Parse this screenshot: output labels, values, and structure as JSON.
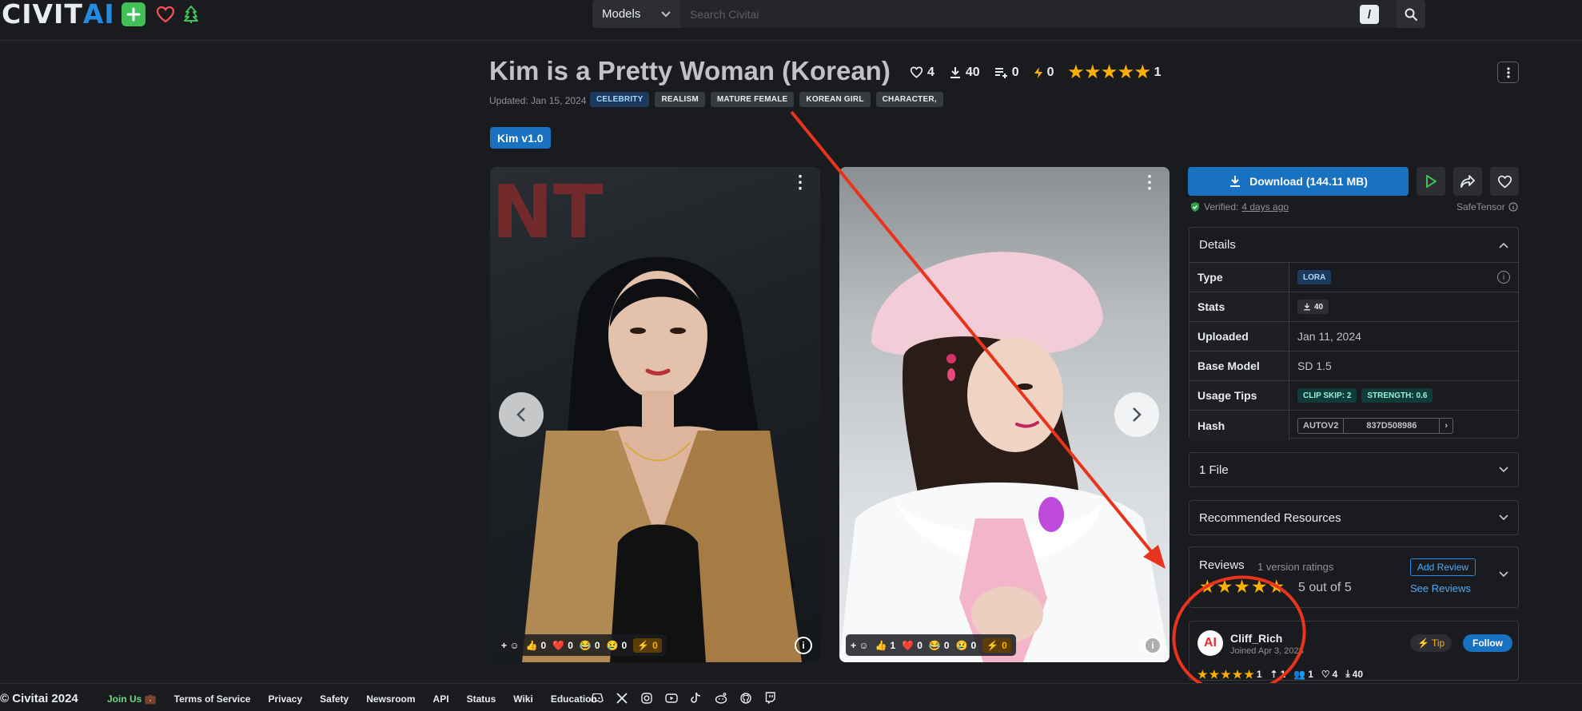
{
  "header": {
    "logo_civ": "CIVIT",
    "logo_ai": "AI",
    "models_select": "Models",
    "search_placeholder": "Search Civitai",
    "slash_key": "/"
  },
  "model": {
    "title": "Kim is a Pretty Woman (Korean)",
    "likes": "4",
    "downloads": "40",
    "collections": "0",
    "buzz": "0",
    "rating_count": "1",
    "updated": "Updated: Jan 15, 2024",
    "tags": [
      "CELEBRITY",
      "REALISM",
      "MATURE FEMALE",
      "KOREAN GIRL",
      "CHARACTER,"
    ],
    "version": "Kim v1.0"
  },
  "images": [
    {
      "reactions": {
        "thumbs": "0",
        "heart": "0",
        "laugh": "0",
        "cry": "0",
        "buzz": "0"
      }
    },
    {
      "reactions": {
        "thumbs": "1",
        "heart": "0",
        "laugh": "0",
        "cry": "0",
        "buzz": "0"
      }
    }
  ],
  "download": {
    "label": "Download (144.11 MB)",
    "verified_prefix": "Verified:",
    "verified_when": "4 days ago",
    "safetensor": "SafeTensor"
  },
  "details": {
    "heading": "Details",
    "rows": {
      "type_label": "Type",
      "type_value": "LORA",
      "stats_label": "Stats",
      "stats_value": "40",
      "uploaded_label": "Uploaded",
      "uploaded_value": "Jan 11, 2024",
      "base_label": "Base Model",
      "base_value": "SD 1.5",
      "tips_label": "Usage Tips",
      "tip1": "CLIP SKIP: 2",
      "tip2": "STRENGTH: 0.6",
      "hash_label": "Hash",
      "hash_type": "AUTOV2",
      "hash_value": "837D508986"
    }
  },
  "files": {
    "label": "1 File"
  },
  "resources": {
    "label": "Recommended Resources"
  },
  "reviews": {
    "title": "Reviews",
    "count": "1 version ratings",
    "score": "5 out of 5",
    "add": "Add Review",
    "see": "See Reviews"
  },
  "creator": {
    "name": "Cliff_Rich",
    "joined": "Joined Apr 3, 2023",
    "tip": "Tip",
    "follow": "Follow",
    "rating_count": "1",
    "uploads": "1",
    "followers": "1",
    "likes": "4",
    "downloads": "40"
  },
  "footer": {
    "copyright": "© Civitai 2024",
    "join": "Join Us 💼",
    "links": [
      "Terms of Service",
      "Privacy",
      "Safety",
      "Newsroom",
      "API",
      "Status",
      "Wiki",
      "Education"
    ]
  },
  "colors": {
    "accent_blue": "#1971c2",
    "star_yellow": "#fab005",
    "annotation_red": "#e8341c"
  }
}
